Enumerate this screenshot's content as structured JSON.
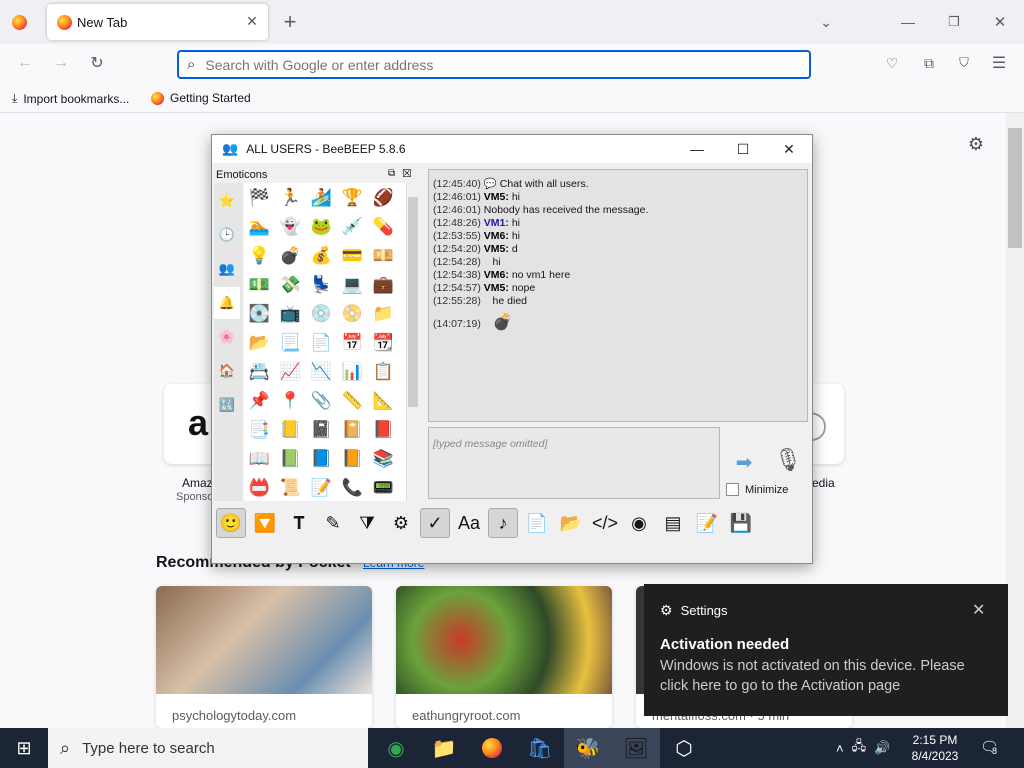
{
  "browser": {
    "tab_title": "New Tab",
    "url_placeholder": "Search with Google or enter address",
    "bookmarks": [
      "Import bookmarks...",
      "Getting Started"
    ]
  },
  "newtab": {
    "tile_label_left": "Amaz",
    "tile_sub_left": "Sponso",
    "tile_label_right": "edia",
    "section_title": "Recommended by Pocket",
    "section_link": "Learn more",
    "cards": [
      "psychologytoday.com",
      "eathungryroot.com",
      "mentalfloss.com · 5 min"
    ]
  },
  "beebeep": {
    "title": "ALL USERS - BeeBEEP 5.8.6",
    "emoticons_label": "Emoticons",
    "messages": [
      {
        "time": "(12:45:40)",
        "user": "",
        "text": "Chat with all users."
      },
      {
        "time": "(12:46:01)",
        "user": "VM5:",
        "text": "hi"
      },
      {
        "time": "(12:46:01)",
        "user": "",
        "text": "Nobody has received the message."
      },
      {
        "time": "(12:48:26)",
        "user": "VM1:",
        "text": "hi"
      },
      {
        "time": "(12:53:55)",
        "user": "VM6:",
        "text": "hi"
      },
      {
        "time": "(12:54:20)",
        "user": "VM5:",
        "text": "d"
      },
      {
        "time": "(12:54:28)",
        "user": "",
        "text": "hi"
      },
      {
        "time": "(12:54:38)",
        "user": "VM6:",
        "text": "no vm1 here"
      },
      {
        "time": "(12:54:57)",
        "user": "VM5:",
        "text": "nope"
      },
      {
        "time": "(12:55:28)",
        "user": "",
        "text": "he died"
      },
      {
        "time": "(14:07:19)",
        "user": "",
        "text": "💣"
      }
    ],
    "input_placeholder": "[typed message omitted]",
    "minimize_label": "Minimize"
  },
  "toast": {
    "app": "Settings",
    "title": "Activation needed",
    "body": "Windows is not activated on this device. Please click here to go to the Activation page"
  },
  "taskbar": {
    "search_placeholder": "Type here to search",
    "time": "2:15 PM",
    "date": "8/4/2023",
    "notifications": "8"
  }
}
